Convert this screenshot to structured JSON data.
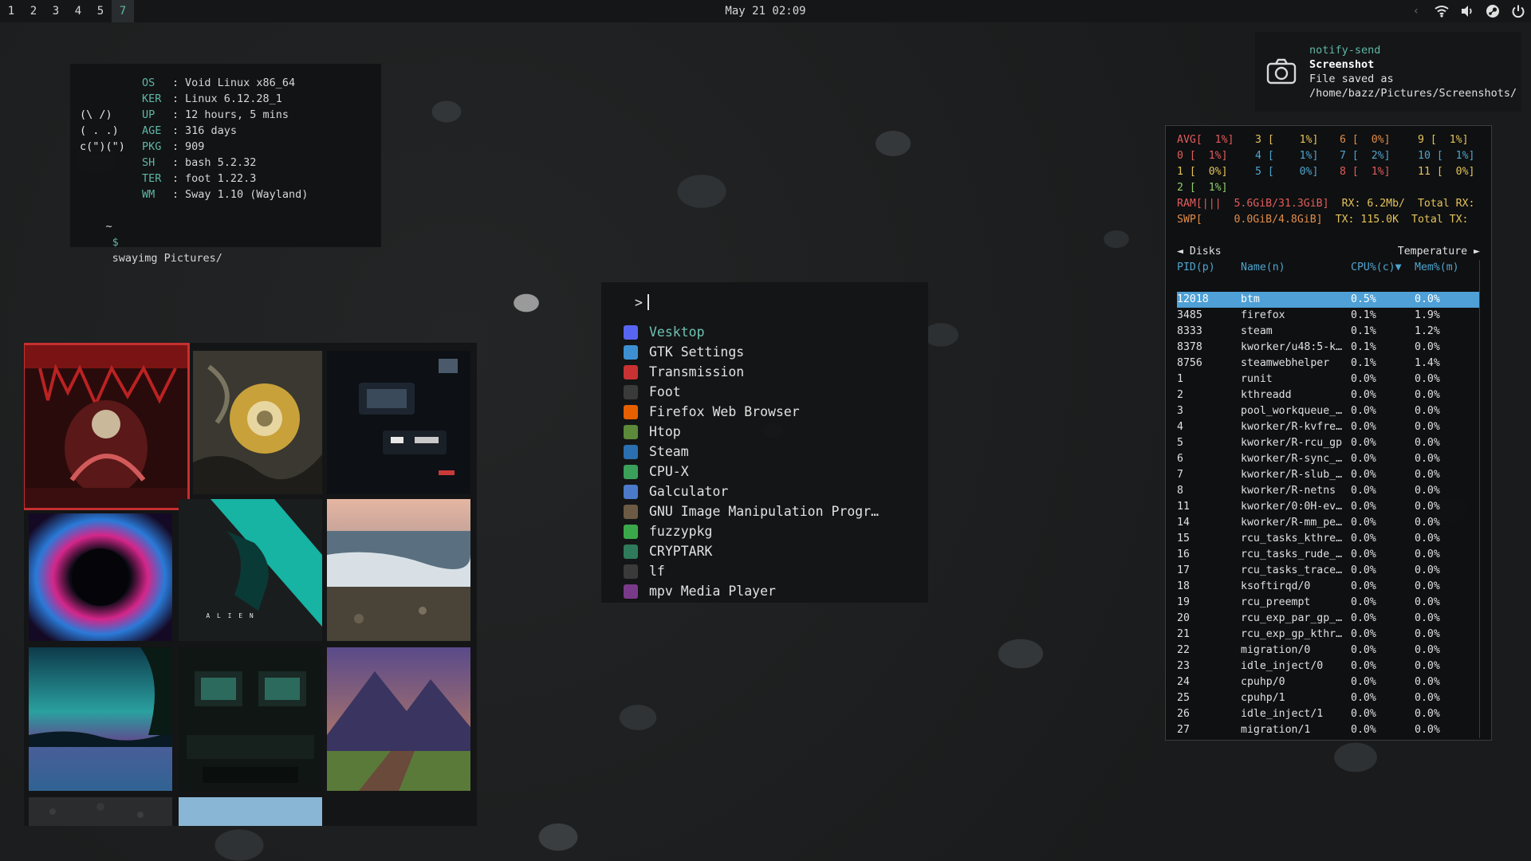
{
  "topbar": {
    "workspaces": [
      {
        "label": "1",
        "active": false
      },
      {
        "label": "2",
        "active": false
      },
      {
        "label": "3",
        "active": false
      },
      {
        "label": "4",
        "active": false
      },
      {
        "label": "5",
        "active": false
      },
      {
        "label": "7",
        "active": true
      }
    ],
    "clock": "May 21 02:09",
    "tray_icons": [
      "chevron-left-icon",
      "wifi-icon",
      "volume-icon",
      "steam-icon",
      "power-icon"
    ]
  },
  "fetch": {
    "art": [
      "",
      "",
      "(\\ /)",
      "( . .)",
      "c(\")(\")",
      "",
      "",
      ""
    ],
    "rows": [
      {
        "key": "OS",
        "value": "Void Linux x86_64"
      },
      {
        "key": "KER",
        "value": "Linux 6.12.28_1"
      },
      {
        "key": "UP",
        "value": "12 hours, 5 mins"
      },
      {
        "key": "AGE",
        "value": "316 days"
      },
      {
        "key": "PKG",
        "value": "909"
      },
      {
        "key": "SH",
        "value": "bash 5.2.32"
      },
      {
        "key": "TER",
        "value": "foot 1.22.3"
      },
      {
        "key": "WM",
        "value": "Sway 1.10 (Wayland)"
      }
    ],
    "separator": ":",
    "prompt_dir": "~",
    "prompt_symbol": "$",
    "command": "swayimg Pictures/"
  },
  "viewer": {
    "thumbs": [
      {
        "name": "thumb-red-warrior",
        "selected": true
      },
      {
        "name": "thumb-golden-flower",
        "selected": false
      },
      {
        "name": "thumb-cockpit-screens",
        "selected": false
      },
      {
        "name": "thumb-neon-portal",
        "selected": false
      },
      {
        "name": "thumb-alien-poster",
        "selected": false,
        "caption": "A L I E N"
      },
      {
        "name": "thumb-beach-waves",
        "selected": false
      },
      {
        "name": "thumb-aurora-lake",
        "selected": false
      },
      {
        "name": "thumb-computer-room",
        "selected": false
      },
      {
        "name": "thumb-mountain-dock",
        "selected": false
      },
      {
        "name": "thumb-gravel",
        "selected": false
      },
      {
        "name": "thumb-sky",
        "selected": false
      }
    ]
  },
  "launcher": {
    "prompt": ">",
    "items": [
      {
        "label": "Vesktop",
        "icon": "vesktop-icon",
        "color": "#5865f2",
        "selected": true
      },
      {
        "label": "GTK Settings",
        "icon": "gtk-settings-icon",
        "color": "#3d8fd1",
        "selected": false
      },
      {
        "label": "Transmission",
        "icon": "transmission-icon",
        "color": "#c83232",
        "selected": false
      },
      {
        "label": "Foot",
        "icon": "terminal-icon",
        "color": "#3a3a3a",
        "selected": false
      },
      {
        "label": "Firefox Web Browser",
        "icon": "firefox-icon",
        "color": "#e66000",
        "selected": false
      },
      {
        "label": "Htop",
        "icon": "htop-icon",
        "color": "#5a8a3a",
        "selected": false
      },
      {
        "label": "Steam",
        "icon": "steam-icon",
        "color": "#2a6fb0",
        "selected": false
      },
      {
        "label": "CPU-X",
        "icon": "cpu-x-icon",
        "color": "#3aa05a",
        "selected": false
      },
      {
        "label": "Galculator",
        "icon": "calculator-icon",
        "color": "#4a7ac8",
        "selected": false
      },
      {
        "label": "GNU Image Manipulation Progr…",
        "icon": "gimp-icon",
        "color": "#6b5a44",
        "selected": false
      },
      {
        "label": "fuzzypkg",
        "icon": "fuzzypkg-icon",
        "color": "#3aa84a",
        "selected": false
      },
      {
        "label": "CRYPTARK",
        "icon": "cryptark-icon",
        "color": "#2e7a5a",
        "selected": false
      },
      {
        "label": "lf",
        "icon": "terminal-icon",
        "color": "#3a3a3a",
        "selected": false
      },
      {
        "label": "mpv Media Player",
        "icon": "mpv-icon",
        "color": "#7a3a8a",
        "selected": false
      }
    ]
  },
  "notification": {
    "app": "notify-send",
    "summary": "Screenshot",
    "body_line1": "File saved as",
    "body_line2": "/home/bazz/Pictures/Screenshots/"
  },
  "btm": {
    "cpu": [
      {
        "label": "AVG[",
        "value": "  1%]",
        "color": "red"
      },
      {
        "label": "3 [",
        "value": "    1%]",
        "color": "yellow"
      },
      {
        "label": "6 [",
        "value": "  0%]",
        "color": "orange"
      },
      {
        "label": "9 [",
        "value": "  1%]",
        "color": "yellow"
      },
      {
        "label": "0 [",
        "value": "  1%]",
        "color": "red"
      },
      {
        "label": "4 [",
        "value": "    1%]",
        "color": "cyan"
      },
      {
        "label": "7 [",
        "value": "  2%]",
        "color": "cyan"
      },
      {
        "label": "10 [",
        "value": "  1%]",
        "color": "cyan"
      },
      {
        "label": "1 [",
        "value": "  0%]",
        "color": "yellow"
      },
      {
        "label": "5 [",
        "value": "    0%]",
        "color": "cyan"
      },
      {
        "label": "8 [",
        "value": "  1%]",
        "color": "red"
      },
      {
        "label": "11 [",
        "value": "  0%]",
        "color": "yellow"
      },
      {
        "label": "2 [",
        "value": "  1%]",
        "color": "green"
      }
    ],
    "ram": "RAM[|||  5.6GiB/31.3GiB]",
    "swp": "SWP[     0.0GiB/4.8GiB]",
    "rx": "RX: 6.2Mb/",
    "tx": "TX: 115.0K",
    "total_rx": "Total RX:",
    "total_tx": "Total TX:",
    "disks_label": "◄ Disks",
    "temp_label": "Temperature ►",
    "headers": {
      "pid": "PID(p)",
      "name": "Name(n)",
      "cpu": "CPU%(c)▼",
      "mem": "Mem%(m)"
    },
    "processes": [
      {
        "pid": "12018",
        "name": "btm",
        "cpu": "0.5%",
        "mem": "0.0%",
        "selected": true
      },
      {
        "pid": "3485",
        "name": "firefox",
        "cpu": "0.1%",
        "mem": "1.9%"
      },
      {
        "pid": "8333",
        "name": "steam",
        "cpu": "0.1%",
        "mem": "1.2%"
      },
      {
        "pid": "8378",
        "name": "kworker/u48:5-k…",
        "cpu": "0.1%",
        "mem": "0.0%"
      },
      {
        "pid": "8756",
        "name": "steamwebhelper",
        "cpu": "0.1%",
        "mem": "1.4%"
      },
      {
        "pid": "1",
        "name": "runit",
        "cpu": "0.0%",
        "mem": "0.0%"
      },
      {
        "pid": "2",
        "name": "kthreadd",
        "cpu": "0.0%",
        "mem": "0.0%"
      },
      {
        "pid": "3",
        "name": "pool_workqueue_…",
        "cpu": "0.0%",
        "mem": "0.0%"
      },
      {
        "pid": "4",
        "name": "kworker/R-kvfre…",
        "cpu": "0.0%",
        "mem": "0.0%"
      },
      {
        "pid": "5",
        "name": "kworker/R-rcu_gp",
        "cpu": "0.0%",
        "mem": "0.0%"
      },
      {
        "pid": "6",
        "name": "kworker/R-sync_…",
        "cpu": "0.0%",
        "mem": "0.0%"
      },
      {
        "pid": "7",
        "name": "kworker/R-slub_…",
        "cpu": "0.0%",
        "mem": "0.0%"
      },
      {
        "pid": "8",
        "name": "kworker/R-netns",
        "cpu": "0.0%",
        "mem": "0.0%"
      },
      {
        "pid": "11",
        "name": "kworker/0:0H-ev…",
        "cpu": "0.0%",
        "mem": "0.0%"
      },
      {
        "pid": "14",
        "name": "kworker/R-mm_pe…",
        "cpu": "0.0%",
        "mem": "0.0%"
      },
      {
        "pid": "15",
        "name": "rcu_tasks_kthre…",
        "cpu": "0.0%",
        "mem": "0.0%"
      },
      {
        "pid": "16",
        "name": "rcu_tasks_rude_…",
        "cpu": "0.0%",
        "mem": "0.0%"
      },
      {
        "pid": "17",
        "name": "rcu_tasks_trace…",
        "cpu": "0.0%",
        "mem": "0.0%"
      },
      {
        "pid": "18",
        "name": "ksoftirqd/0",
        "cpu": "0.0%",
        "mem": "0.0%"
      },
      {
        "pid": "19",
        "name": "rcu_preempt",
        "cpu": "0.0%",
        "mem": "0.0%"
      },
      {
        "pid": "20",
        "name": "rcu_exp_par_gp_…",
        "cpu": "0.0%",
        "mem": "0.0%"
      },
      {
        "pid": "21",
        "name": "rcu_exp_gp_kthr…",
        "cpu": "0.0%",
        "mem": "0.0%"
      },
      {
        "pid": "22",
        "name": "migration/0",
        "cpu": "0.0%",
        "mem": "0.0%"
      },
      {
        "pid": "23",
        "name": "idle_inject/0",
        "cpu": "0.0%",
        "mem": "0.0%"
      },
      {
        "pid": "24",
        "name": "cpuhp/0",
        "cpu": "0.0%",
        "mem": "0.0%"
      },
      {
        "pid": "25",
        "name": "cpuhp/1",
        "cpu": "0.0%",
        "mem": "0.0%"
      },
      {
        "pid": "26",
        "name": "idle_inject/1",
        "cpu": "0.0%",
        "mem": "0.0%"
      },
      {
        "pid": "27",
        "name": "migration/1",
        "cpu": "0.0%",
        "mem": "0.0%"
      }
    ]
  }
}
